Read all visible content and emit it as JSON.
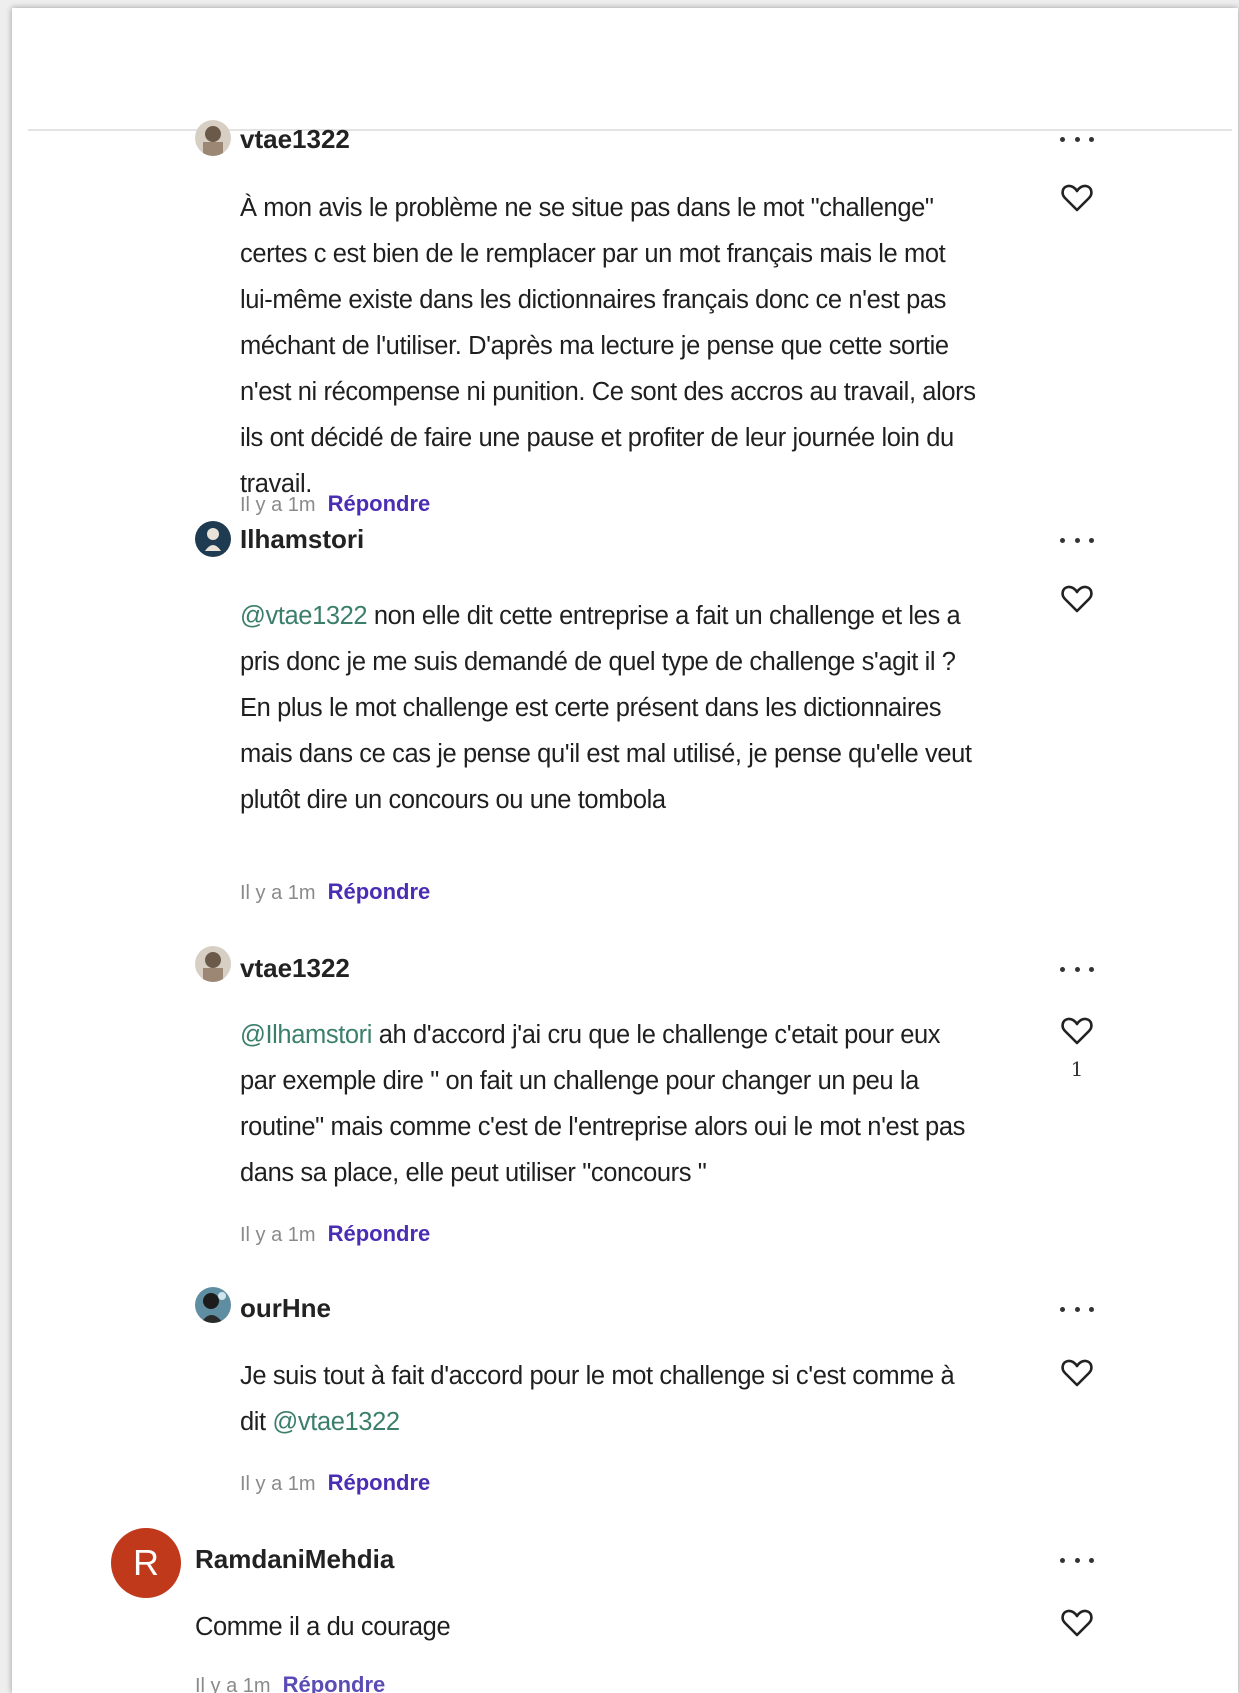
{
  "comments": [
    {
      "username": "vtae1322",
      "mention": "",
      "text": "À mon avis le problème ne se situe pas dans le mot \"challenge\" certes c est bien de le remplacer par un mot français mais le mot lui-même existe dans les dictionnaires français donc ce n'est pas méchant de l'utiliser. D'après ma lecture je pense que cette sortie n'est ni récompense ni punition. Ce sont des accros au travail, alors ils ont décidé de faire une pause et profiter de leur journée loin du travail.",
      "time": "Il y a 1m",
      "reply_label": "Répondre",
      "like_count": ""
    },
    {
      "username": "Ilhamstori",
      "mention": "@vtae1322",
      "text": " non elle dit cette entreprise a fait un challenge et les a pris donc je me suis demandé de quel type de challenge s'agit il ? En plus le mot challenge est certe présent dans les dictionnaires mais dans ce cas je pense qu'il est mal utilisé, je pense qu'elle veut plutôt dire un concours ou une tombola",
      "time": "Il y a 1m",
      "reply_label": "Répondre",
      "like_count": ""
    },
    {
      "username": "vtae1322",
      "mention": "@Ilhamstori",
      "text": " ah d'accord j'ai cru que le challenge c'etait pour eux par exemple dire \" on fait un challenge pour changer un peu la routine\" mais comme c'est de l'entreprise alors oui le mot n'est pas dans sa place, elle peut utiliser \"concours \"",
      "time": "Il y a 1m",
      "reply_label": "Répondre",
      "like_count": "1"
    },
    {
      "username": "ourHne",
      "mention": "",
      "text": "Je suis tout à fait d'accord pour le mot challenge si c'est comme à dit ",
      "mention_after": "@vtae1322",
      "time": "Il y a 1m",
      "reply_label": "Répondre",
      "like_count": ""
    },
    {
      "username": "RamdaniMehdia",
      "avatar_letter": "R",
      "avatar_color": "#c0391b",
      "mention": "",
      "text": "Comme il a du courage",
      "time": "Il y a 1m",
      "reply_label": "Répondre",
      "like_count": ""
    }
  ],
  "colors": {
    "mention": "#3b7f6b",
    "reply": "#4b2db3",
    "time": "#8a8a8a"
  },
  "icons": [
    "more-options-icon",
    "heart-icon"
  ]
}
